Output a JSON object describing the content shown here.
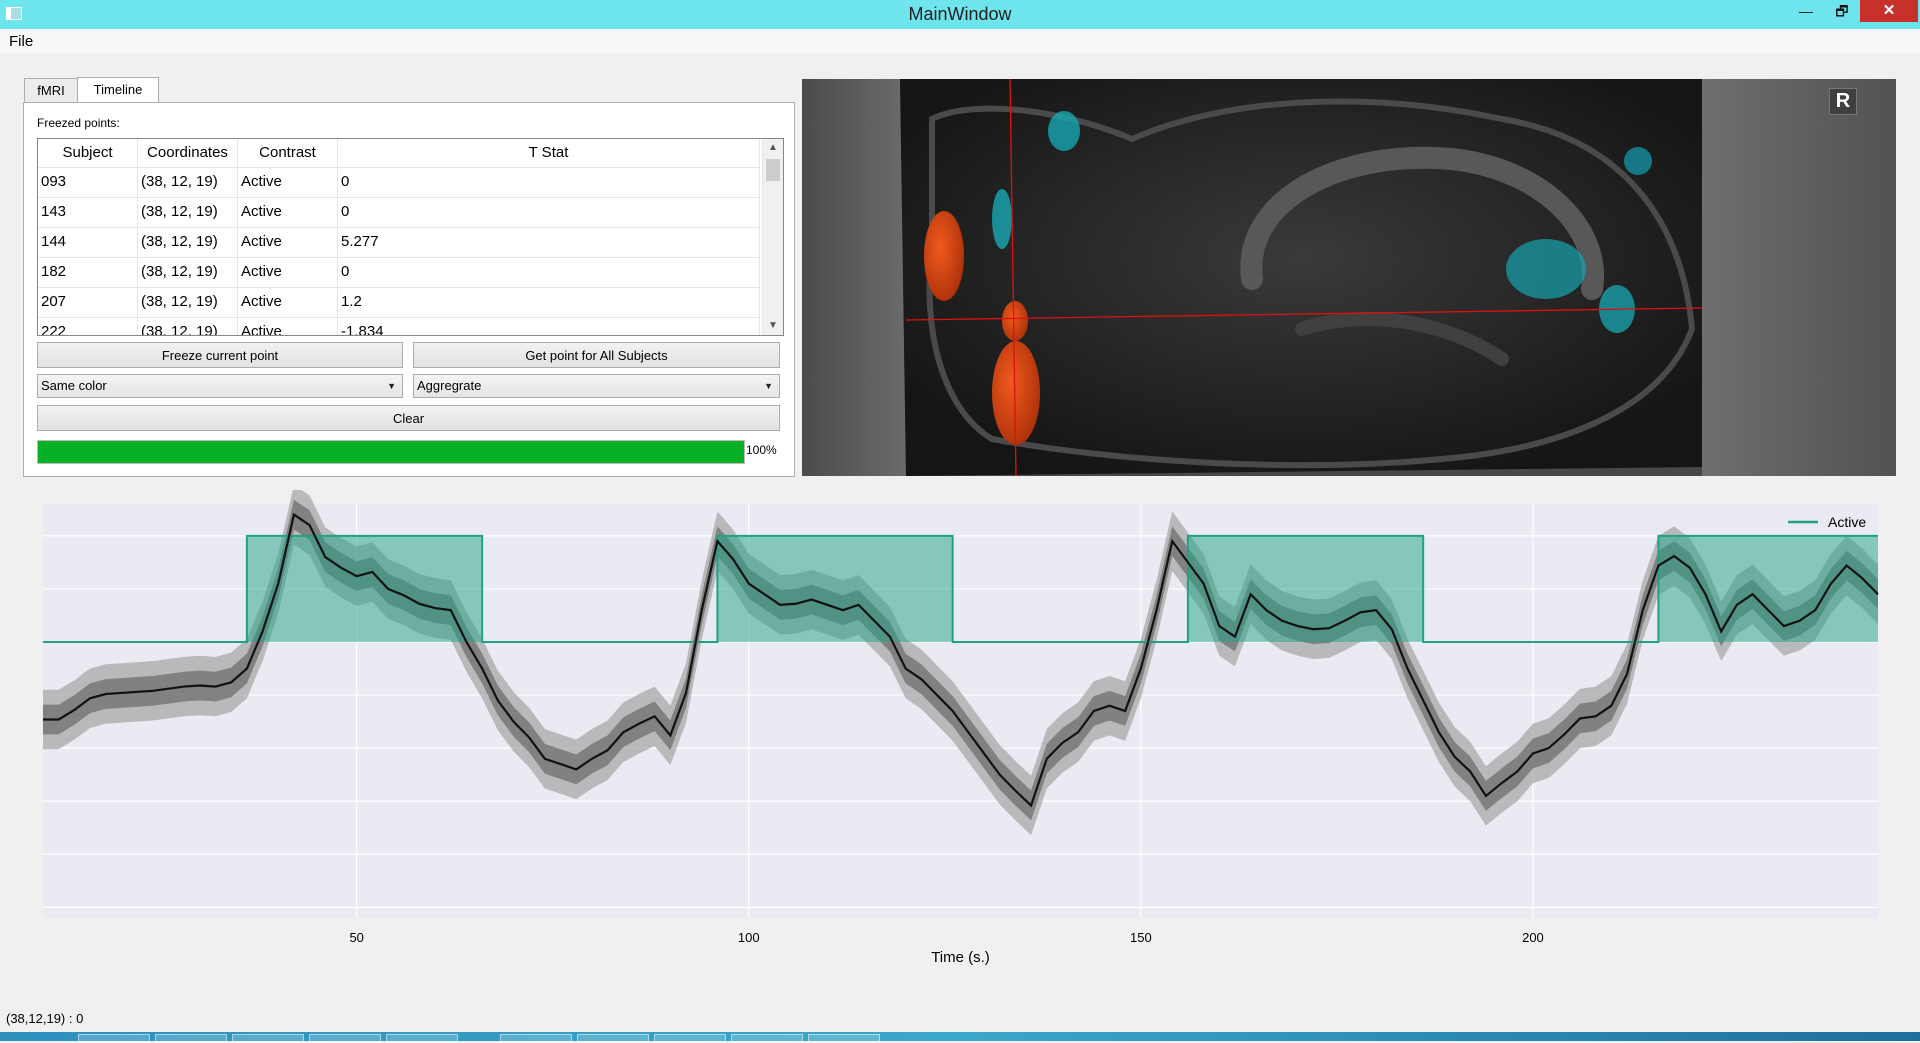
{
  "window": {
    "title": "MainWindow",
    "minimize": "—",
    "maximize": "🗗",
    "close": "✕"
  },
  "menu": {
    "file": "File"
  },
  "tabs": [
    {
      "label": "fMRI"
    },
    {
      "label": "Timeline"
    }
  ],
  "timeline": {
    "freezed_label": "Freezed points:",
    "columns": [
      "Subject",
      "Coordinates",
      "Contrast",
      "T Stat"
    ],
    "rows": [
      [
        "093",
        "(38, 12, 19)",
        "Active",
        "0"
      ],
      [
        "143",
        "(38, 12, 19)",
        "Active",
        "0"
      ],
      [
        "144",
        "(38, 12, 19)",
        "Active",
        "5.277"
      ],
      [
        "182",
        "(38, 12, 19)",
        "Active",
        "0"
      ],
      [
        "207",
        "(38, 12, 19)",
        "Active",
        "1.2"
      ],
      [
        "222",
        "(38, 12, 19)",
        "Active",
        "-1.834"
      ]
    ],
    "freeze_button": "Freeze current point",
    "get_all_button": "Get point for All Subjects",
    "color_select": "Same color",
    "aggregate_select": "Aggregrate",
    "clear_button": "Clear",
    "progress": 100,
    "progress_label": "100%"
  },
  "viewer": {
    "r_button": "R"
  },
  "chart_data": {
    "type": "line",
    "xlabel": "Time (s.)",
    "xlim": [
      10,
      244
    ],
    "ylim": [
      -2.6,
      1.3
    ],
    "xticks": [
      50,
      100,
      150,
      200
    ],
    "grid": true,
    "legend": {
      "position": "top-right",
      "entries": [
        "Active"
      ]
    },
    "colors": {
      "active": "#1fa383",
      "mean": "#111111",
      "band_inner": "#6f6f6f",
      "band_outer": "#a8a8a8",
      "background": "#eaeaf2"
    },
    "series": [
      {
        "name": "Active",
        "type": "step",
        "x": [
          10,
          36,
          36,
          66,
          66,
          96,
          96,
          126,
          126,
          156,
          156,
          186,
          186,
          216,
          216,
          244
        ],
        "values": [
          0,
          0,
          1,
          1,
          0,
          0,
          1,
          1,
          0,
          0,
          1,
          1,
          0,
          0,
          1,
          1
        ]
      },
      {
        "type": "line",
        "x": [
          10,
          12,
          14,
          16,
          18,
          20,
          22,
          24,
          26,
          28,
          30,
          32,
          34,
          36,
          38,
          40,
          42,
          44,
          46,
          48,
          50,
          52,
          54,
          56,
          58,
          60,
          62,
          64,
          66,
          68,
          70,
          72,
          74,
          76,
          78,
          80,
          82,
          84,
          86,
          88,
          90,
          92,
          94,
          96,
          98,
          100,
          102,
          104,
          106,
          108,
          110,
          112,
          114,
          116,
          118,
          120,
          122,
          124,
          126,
          128,
          130,
          132,
          134,
          136,
          138,
          140,
          142,
          144,
          146,
          148,
          150,
          152,
          154,
          156,
          158,
          160,
          162,
          164,
          166,
          168,
          170,
          172,
          174,
          176,
          178,
          180,
          182,
          184,
          186,
          188,
          190,
          192,
          194,
          196,
          198,
          200,
          202,
          204,
          206,
          208,
          210,
          212,
          214,
          216,
          218,
          220,
          222,
          224,
          226,
          228,
          230,
          232,
          234,
          236,
          238,
          240,
          242,
          244
        ],
        "values": [
          -0.73,
          -0.73,
          -0.64,
          -0.53,
          -0.49,
          -0.48,
          -0.47,
          -0.46,
          -0.44,
          -0.42,
          -0.41,
          -0.42,
          -0.38,
          -0.25,
          0.1,
          0.55,
          1.2,
          1.1,
          0.8,
          0.7,
          0.62,
          0.66,
          0.5,
          0.44,
          0.36,
          0.32,
          0.3,
          0.0,
          -0.25,
          -0.55,
          -0.75,
          -0.9,
          -1.1,
          -1.15,
          -1.2,
          -1.1,
          -1.02,
          -0.85,
          -0.77,
          -0.7,
          -0.88,
          -0.48,
          0.3,
          0.95,
          0.78,
          0.55,
          0.45,
          0.35,
          0.36,
          0.4,
          0.35,
          0.3,
          0.35,
          0.2,
          0.05,
          -0.25,
          -0.35,
          -0.5,
          -0.65,
          -0.85,
          -1.05,
          -1.25,
          -1.4,
          -1.54,
          -1.1,
          -0.95,
          -0.85,
          -0.65,
          -0.6,
          -0.65,
          -0.25,
          0.3,
          0.95,
          0.75,
          0.55,
          0.15,
          0.05,
          0.45,
          0.3,
          0.2,
          0.15,
          0.12,
          0.13,
          0.2,
          0.28,
          0.3,
          0.12,
          -0.25,
          -0.55,
          -0.85,
          -1.08,
          -1.22,
          -1.45,
          -1.33,
          -1.22,
          -1.05,
          -1.0,
          -0.87,
          -0.72,
          -0.7,
          -0.6,
          -0.3,
          0.3,
          0.72,
          0.81,
          0.7,
          0.45,
          0.1,
          0.35,
          0.45,
          0.3,
          0.15,
          0.2,
          0.3,
          0.55,
          0.72,
          0.6,
          0.45
        ]
      }
    ]
  },
  "status": {
    "text": "(38,12,19) : 0"
  }
}
